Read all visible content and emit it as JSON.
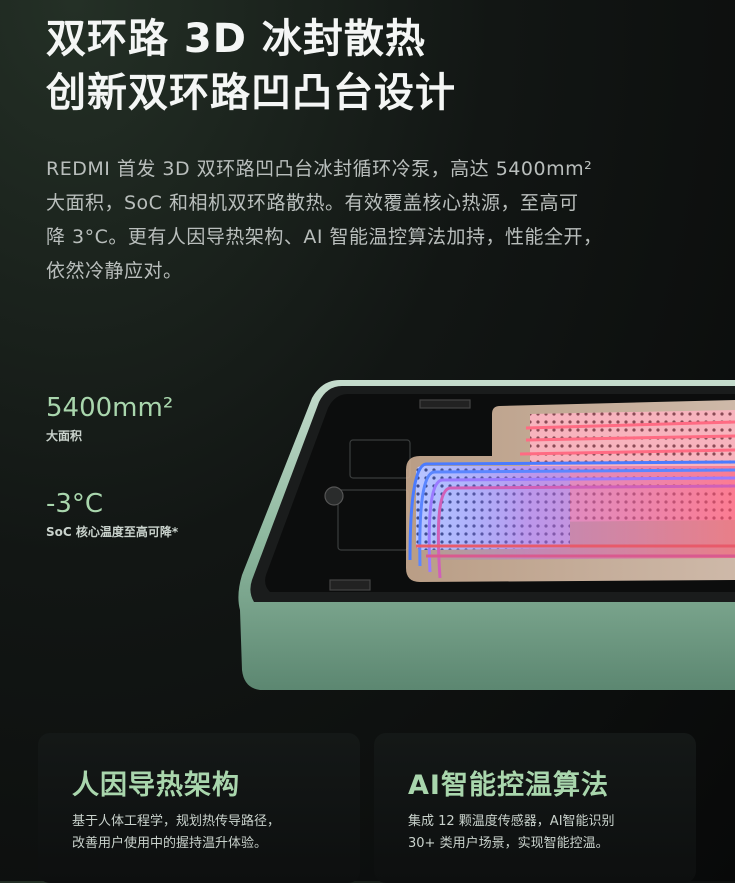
{
  "headline": {
    "line1": "双环路 3D 冰封散热",
    "line2": "创新双环路凹凸台设计"
  },
  "description": {
    "line1": "REDMI 首发 3D 双环路凹凸台冰封循环冷泵，高达 5400mm²",
    "line2": "大面积，SoC 和相机双环路散热。有效覆盖核心热源，至高可",
    "line3": "降 3°C。更有人因导热架构、AI 智能温控算法加持，性能全开，",
    "line4": "依然冷静应对。"
  },
  "stats": [
    {
      "value": "5400mm²",
      "label": "大面积"
    },
    {
      "value": "-3°C",
      "label": "SoC 核心温度至高可降*"
    }
  ],
  "cards": [
    {
      "title": "人因导热架构",
      "line1": "基于人体工程学，规划热传导路径，",
      "line2": "改善用户使用中的握持温升体验。"
    },
    {
      "title": "AI智能控温算法",
      "line1": "集成 12 颗温度传感器，AI智能识别",
      "line2": "30+ 类用户场景，实现智能控温。"
    }
  ],
  "colors": {
    "accent": "#a9d6ad",
    "frame": "#8fb9a0",
    "hot": "#e85a6a",
    "cold": "#4a7bff"
  }
}
